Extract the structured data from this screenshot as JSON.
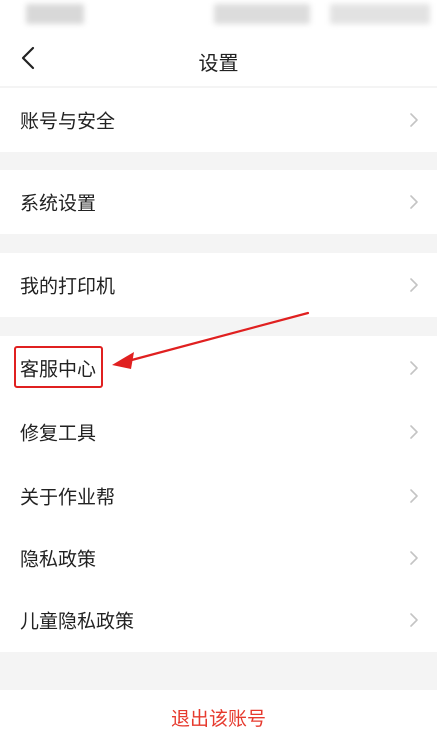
{
  "header": {
    "title": "设置",
    "back_icon": "chevron-left-icon"
  },
  "groups": [
    {
      "items": [
        {
          "label": "账号与安全"
        }
      ]
    },
    {
      "items": [
        {
          "label": "系统设置"
        }
      ]
    },
    {
      "items": [
        {
          "label": "我的打印机"
        }
      ]
    },
    {
      "items": [
        {
          "label": "客服中心",
          "highlighted": true
        },
        {
          "label": "修复工具"
        },
        {
          "label": "关于作业帮"
        },
        {
          "label": "隐私政策"
        },
        {
          "label": "儿童隐私政策"
        }
      ]
    }
  ],
  "footer": {
    "logout_label": "退出该账号"
  },
  "colors": {
    "accent": "#e63a2e",
    "annotation": "#e02020",
    "background": "#f4f4f4"
  },
  "icons": {
    "row_icon": "chevron-right-icon"
  }
}
